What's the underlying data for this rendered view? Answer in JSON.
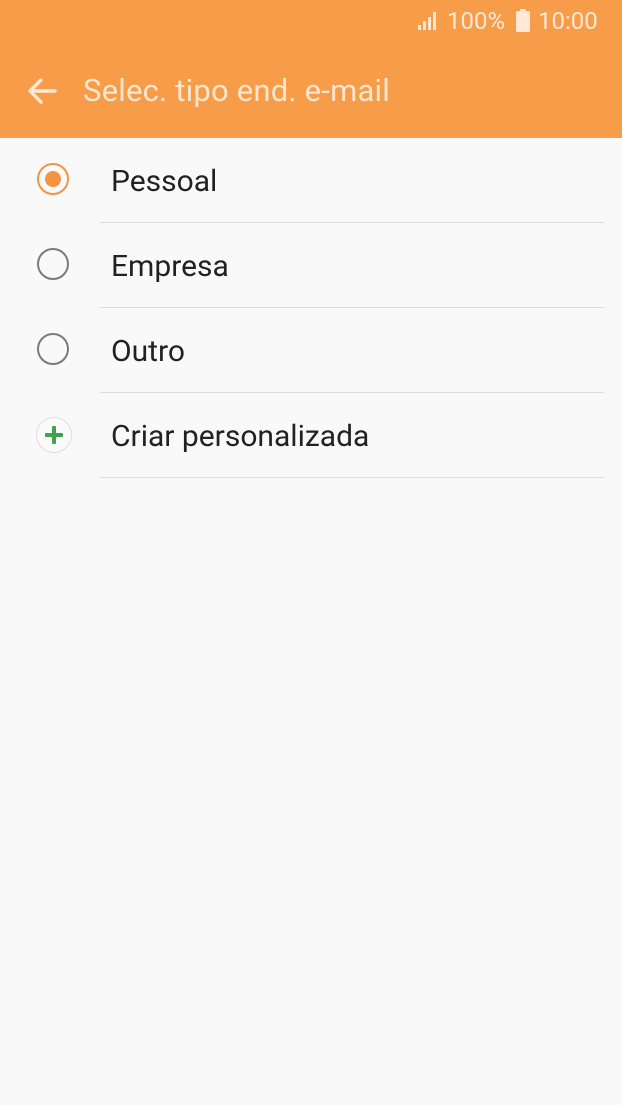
{
  "status_bar": {
    "battery": "100%",
    "time": "10:00",
    "signal_icon": "signal-icon",
    "battery_icon": "battery-icon"
  },
  "app_bar": {
    "title": "Selec. tipo end. e-mail",
    "back_icon": "arrow-back-icon",
    "background_color": "#f79c48"
  },
  "options": [
    {
      "label": "Pessoal",
      "selected": true
    },
    {
      "label": "Empresa",
      "selected": false
    },
    {
      "label": "Outro",
      "selected": false
    }
  ],
  "custom_option": {
    "label": "Criar personalizada",
    "icon": "add-icon",
    "icon_color": "#3fa34d"
  },
  "accent_color": "#f39442"
}
